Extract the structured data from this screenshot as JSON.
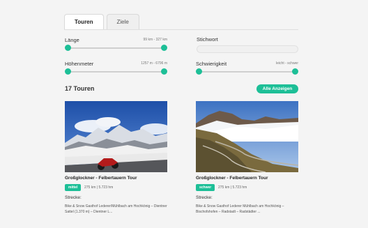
{
  "tabs": [
    {
      "label": "Touren",
      "active": true
    },
    {
      "label": "Ziele",
      "active": false
    }
  ],
  "filters": {
    "length": {
      "label": "Länge",
      "range": "99 km - 327 km",
      "min_value": 99,
      "max_value": 327,
      "unit": "km"
    },
    "elevation": {
      "label": "Höhenmeter",
      "range": "1257 m - 6796 m",
      "min_value": 1257,
      "max_value": 6796,
      "unit": "m"
    },
    "keyword": {
      "label": "Stichwort",
      "placeholder": ""
    },
    "difficulty": {
      "label": "Schwierigkeit",
      "range": "leicht - schwer",
      "min_value": "leicht",
      "max_value": "schwer"
    }
  },
  "results": {
    "count_label": "17 Touren",
    "show_all_label": "Alle Anzeigen"
  },
  "tours": [
    {
      "title": "Großglockner - Felbertauern Tour",
      "difficulty": "mittel",
      "meta": "275 km | 5.723 hm",
      "strecke_label": "Strecke:",
      "route": "Bike & Snow Gasthof Lederer/Mühlbach am Hochkönig – Dientner Sattel (1.370 m) – Dientner L..."
    },
    {
      "title": "Großglockner - Felbertauern Tour",
      "difficulty": "schwer",
      "meta": "275 km | 5.723 hm",
      "strecke_label": "Strecke:",
      "route": "Bike & Snow Gasthof Lederer Mühlbach am Hochkönig – Bischofshofen – Radstadt – Radstädter ..."
    }
  ],
  "colors": {
    "accent": "#1dbf97",
    "background": "#f4f4f4"
  }
}
